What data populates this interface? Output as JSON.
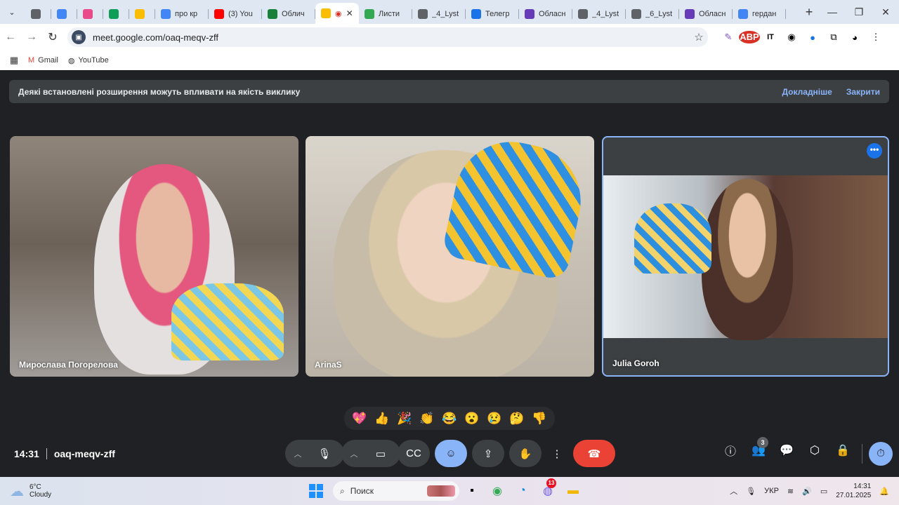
{
  "browser": {
    "tabs": [
      {
        "title": "",
        "color": "#5f6368"
      },
      {
        "title": "",
        "color": "#4285f4"
      },
      {
        "title": "",
        "color": "#e94b8a"
      },
      {
        "title": "",
        "color": "#0f9d58"
      },
      {
        "title": "",
        "color": "#fbbc04"
      },
      {
        "title": "про кр",
        "color": "#4285f4"
      },
      {
        "title": "(3) You",
        "color": "#ff0000"
      },
      {
        "title": "Облич",
        "color": "#188038"
      },
      {
        "title": "",
        "color": "#fbbc04",
        "active": true
      },
      {
        "title": "Листи",
        "color": "#34a853"
      },
      {
        "title": "_4_Lyst",
        "color": "#5f6368"
      },
      {
        "title": "Телегр",
        "color": "#1a73e8"
      },
      {
        "title": "Обласн",
        "color": "#673ab7"
      },
      {
        "title": "_4_Lyst",
        "color": "#5f6368"
      },
      {
        "title": "_6_Lyst",
        "color": "#5f6368"
      },
      {
        "title": "Обласн",
        "color": "#673ab7"
      },
      {
        "title": "гердан",
        "color": "#4285f4"
      }
    ],
    "new_tab": "+",
    "url": "meet.google.com/oaq-meqv-zff",
    "bookmarks": [
      {
        "label": "Gmail",
        "icon": "gmail-icon"
      },
      {
        "label": "YouTube",
        "icon": "youtube-icon"
      }
    ]
  },
  "meet": {
    "banner": {
      "text": "Деякі встановлені розширення можуть впливати на якість виклику",
      "learn_more": "Докладніше",
      "close": "Закрити"
    },
    "participants": [
      {
        "name": "Мирослава Погорелова"
      },
      {
        "name": "ArinaS"
      },
      {
        "name": "Julia Goroh"
      }
    ],
    "reactions": [
      "💖",
      "👍",
      "🎉",
      "👏",
      "😂",
      "😮",
      "😢",
      "🤔",
      "👎"
    ],
    "time": "14:31",
    "meeting_code": "oaq-meqv-zff",
    "people_count": "3"
  },
  "taskbar": {
    "weather": {
      "temp": "6°C",
      "desc": "Cloudy"
    },
    "search_placeholder": "Поиск",
    "viber_badge": "13",
    "lang": "УКР",
    "time": "14:31",
    "date": "27.01.2025"
  },
  "colors": {
    "accent": "#8ab4f8",
    "end_call": "#ea4335",
    "meet_bg": "#202124"
  }
}
